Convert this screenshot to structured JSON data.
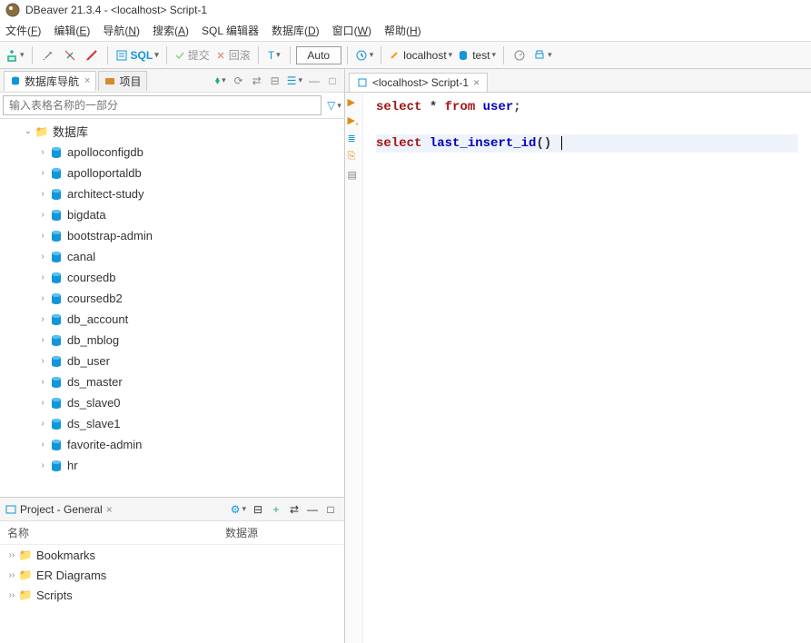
{
  "title": "DBeaver 21.3.4 - <localhost> Script-1",
  "menu": [
    "文件(F)",
    "编辑(E)",
    "导航(N)",
    "搜索(A)",
    "SQL 编辑器",
    "数据库(D)",
    "窗口(W)",
    "帮助(H)"
  ],
  "toolbar": {
    "sql_label": "SQL",
    "commit": "提交",
    "rollback": "回滚",
    "auto": "Auto",
    "conn": "localhost",
    "db": "test"
  },
  "nav": {
    "tab1": "数据库导航",
    "tab2": "项目",
    "filter_placeholder": "输入表格名称的一部分",
    "root": "数据库",
    "items": [
      "apolloconfigdb",
      "apolloportaldb",
      "architect-study",
      "bigdata",
      "bootstrap-admin",
      "canal",
      "coursedb",
      "coursedb2",
      "db_account",
      "db_mblog",
      "db_user",
      "ds_master",
      "ds_slave0",
      "ds_slave1",
      "favorite-admin",
      "hr"
    ]
  },
  "project": {
    "title": "Project - General",
    "col1": "名称",
    "col2": "数据源",
    "items": [
      "Bookmarks",
      "ER Diagrams",
      "Scripts"
    ]
  },
  "editor": {
    "tab": "<localhost> Script-1",
    "line1_kw1": "select",
    "line1_op": "*",
    "line1_kw2": "from",
    "line1_tbl": "user",
    "line1_end": ";",
    "line3_kw": "select",
    "line3_fn": "last_insert_id",
    "line3_paren": "()"
  }
}
